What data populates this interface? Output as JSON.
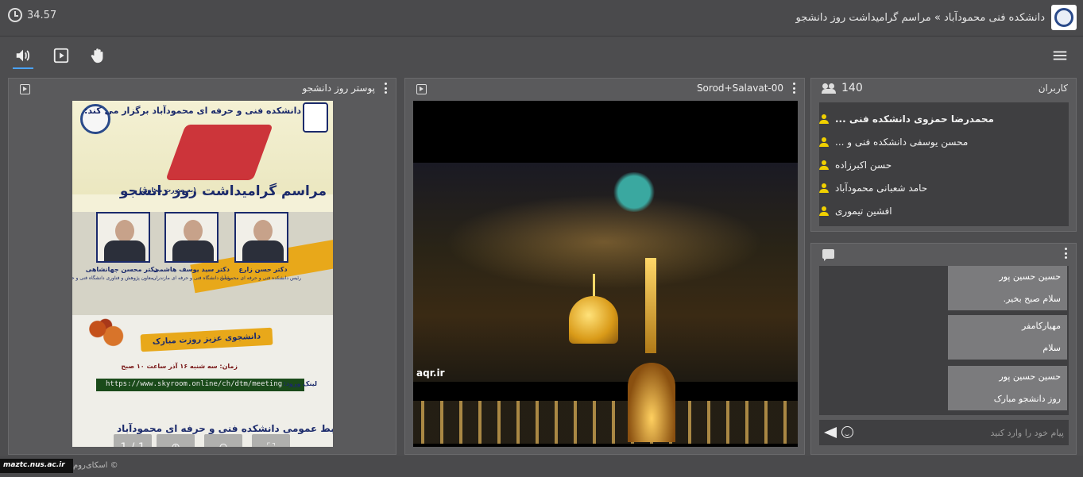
{
  "header": {
    "timer": "34.57",
    "title": "دانشکده فنی محمودآباد » مراسم گرامیداشت روز دانشجو"
  },
  "toolbar": {
    "icons": [
      "speaker-icon",
      "play-icon",
      "hand-icon",
      "menu-icon"
    ],
    "accent": "#4aa3ff"
  },
  "poster_panel": {
    "title": "پوستر روز دانشجو",
    "poster": {
      "heading": "دانشکده فنی و حرفه ای محمودآباد برگزار می کند:",
      "event": "مراسم گرامیداشت روز دانشجو",
      "virtual_note": "(به صورت مجازی)",
      "speakers": [
        {
          "name": "دکتر حسن زارع",
          "role": "رئیس دانشکده فنی و حرفه ای محمودآباد"
        },
        {
          "name": "دکتر سید یوسف هاشمی",
          "role": "رئیس دانشگاه فنی و حرفه ای مازندران"
        },
        {
          "name": "دکتر محسن جهانشاهی",
          "role": "معاون پژوهش و فناوری دانشگاه فنی و حرفه ای"
        }
      ],
      "greeting": "دانشجوی عزیز روزت مبارک",
      "time": "زمان: سه شنبه ۱۶ آذر ساعت ۱۰ صبح",
      "link_label": "لینک ورود:",
      "link": "https://www.skyroom.online/ch/dtm/meeting",
      "footer": "روابط عمومی دانشکده فنی و حرفه ای محمودآباد"
    },
    "viewer_controls": {
      "page": "1 / 1",
      "zoom_in": "⊕",
      "zoom_out": "⊖",
      "fullscreen": "⛶"
    }
  },
  "video_panel": {
    "title": "Sorod+Salavat-00",
    "watermark": "aqr.ir"
  },
  "users_panel": {
    "title": "کاربران",
    "count": "140",
    "users": [
      "محمدرضا حمزوی دانشکده فنی ...",
      "محسن یوسفی دانشکده فنی و ...",
      "حسن اکبرزاده",
      "حامد شعبانی محمودآباد",
      "افشین تیموری"
    ],
    "user_icon_color": "#f0d000"
  },
  "chat_panel": {
    "messages": [
      {
        "user": "حسین حسین پور",
        "text": "سلام صبح بخیر."
      },
      {
        "user": "مهیارکامفر",
        "text": "سلام"
      },
      {
        "user": "حسین حسین پور",
        "text": "روز دانشجو مبارک"
      }
    ],
    "input_placeholder": "پیام خود را وارد کنید"
  },
  "footer": {
    "brand": "maztc.nus.ac.ir",
    "tail": "اسکای‌روم ©"
  }
}
